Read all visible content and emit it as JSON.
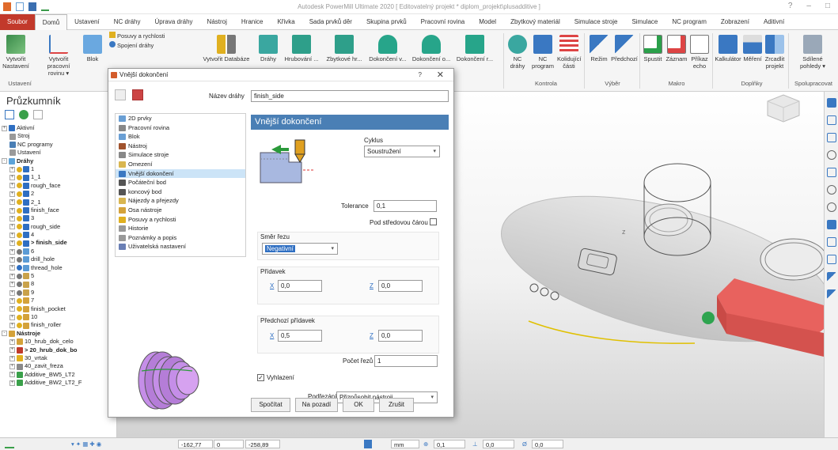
{
  "app": {
    "title": "Autodesk PowerMill Ultimate 2020  [ Editovatelný projekt * diplom_projekt\\plusadditive ]"
  },
  "tabs": [
    "Soubor",
    "Domů",
    "Ustavení",
    "NC dráhy",
    "Úprava dráhy",
    "Nástroj",
    "Hranice",
    "Křivka",
    "Sada prvků děr",
    "Skupina prvků",
    "Pracovní rovina",
    "Model",
    "Zbytkový materiál",
    "Simulace stroje",
    "Simulace",
    "NC program",
    "Zobrazení",
    "Aditivní"
  ],
  "ribbon": {
    "vytvorit_nastaveni": "Vytvořit Nastavení",
    "vytvorit_pracovni_rovinu": "Vytvořit pracovní rovinu ▾",
    "blok": "Blok",
    "posuvy": "Posuvy a rychlosti",
    "spojeni": "Spojení dráhy",
    "vytvorit_nastroj": "Vytvořit Databáze",
    "drahy": "Dráhy",
    "hrubovani": "Hrubování ...",
    "zbytkove": "Zbytkové hr...",
    "dokonceni_v": "Dokončení v...",
    "dokonceni_o": "Dokončení o...",
    "dokonceni_r": "Dokončení r...",
    "nc_drahy": "NC dráhy",
    "nc_program": "NC program",
    "kolidujici": "Kolidující části",
    "rezim": "Režim",
    "predchozi": "Předchozí",
    "spustit": "Spustit",
    "zaznam": "Záznam",
    "prikaz": "Příkaz echo",
    "kalkulator": "Kalkulátor",
    "mereni": "Měření",
    "zrcadlit": "Zrcadlit projekt",
    "sdilene": "Sdílené pohledy ▾",
    "groups": {
      "ustaveni": "Ustavení",
      "kontrola": "Kontrola",
      "vyber": "Výběr",
      "makro": "Makro",
      "doplnky": "Doplňky",
      "spoluprace": "Spolupracovat"
    }
  },
  "explorer": {
    "title": "Průzkumník",
    "tree": [
      {
        "label": "Aktivní",
        "indent": 0,
        "pm": "+",
        "color": "#2f6fc2"
      },
      {
        "label": "Stroj",
        "indent": 1,
        "pm": "",
        "color": "#999"
      },
      {
        "label": "NC programy",
        "indent": 1,
        "pm": "",
        "color": "#4a7fb5"
      },
      {
        "label": "Ustavení",
        "indent": 1,
        "pm": "",
        "color": "#9a9a9a"
      },
      {
        "label": "Dráhy",
        "indent": 0,
        "pm": "-",
        "color": "#5ba3d9",
        "bold": true
      },
      {
        "label": "1",
        "indent": 1,
        "pm": "+",
        "color": "#2f6fc2",
        "status": "#e0b020"
      },
      {
        "label": "1_1",
        "indent": 1,
        "pm": "+",
        "color": "#2f6fc2",
        "status": "#e0b020"
      },
      {
        "label": "rough_face",
        "indent": 1,
        "pm": "+",
        "color": "#2f6fc2",
        "status": "#e0b020"
      },
      {
        "label": "2",
        "indent": 1,
        "pm": "+",
        "color": "#2f6fc2",
        "status": "#e0b020"
      },
      {
        "label": "2_1",
        "indent": 1,
        "pm": "+",
        "color": "#2f6fc2",
        "status": "#e0b020"
      },
      {
        "label": "finish_face",
        "indent": 1,
        "pm": "+",
        "color": "#2f6fc2",
        "status": "#e0b020"
      },
      {
        "label": "3",
        "indent": 1,
        "pm": "+",
        "color": "#2f6fc2",
        "status": "#e0b020"
      },
      {
        "label": "rough_side",
        "indent": 1,
        "pm": "+",
        "color": "#2f6fc2",
        "status": "#e0b020"
      },
      {
        "label": "4",
        "indent": 1,
        "pm": "+",
        "color": "#2f6fc2",
        "status": "#e0b020"
      },
      {
        "label": "> finish_side",
        "indent": 1,
        "pm": "+",
        "color": "#2f6fc2",
        "status": "#e0b020",
        "bold": true
      },
      {
        "label": "6",
        "indent": 1,
        "pm": "+",
        "color": "#5b9bd5",
        "status": "#777"
      },
      {
        "label": "drill_hole",
        "indent": 1,
        "pm": "+",
        "color": "#5b9bd5",
        "status": "#777"
      },
      {
        "label": "thread_hole",
        "indent": 1,
        "pm": "+",
        "color": "#5b9bd5",
        "status": "#2f6fc2"
      },
      {
        "label": "5",
        "indent": 1,
        "pm": "+",
        "color": "#c9a24a",
        "status": "#777"
      },
      {
        "label": "8",
        "indent": 1,
        "pm": "+",
        "color": "#c9a24a",
        "status": "#777"
      },
      {
        "label": "9",
        "indent": 1,
        "pm": "+",
        "color": "#c9a24a",
        "status": "#777"
      },
      {
        "label": "7",
        "indent": 1,
        "pm": "+",
        "color": "#d4a23a",
        "status": "#e0b020"
      },
      {
        "label": "finish_pocket",
        "indent": 1,
        "pm": "+",
        "color": "#d4a23a",
        "status": "#e0b020"
      },
      {
        "label": "10",
        "indent": 1,
        "pm": "+",
        "color": "#d4a23a",
        "status": "#e0b020"
      },
      {
        "label": "finish_roller",
        "indent": 1,
        "pm": "+",
        "color": "#d4a23a",
        "status": "#e0b020"
      },
      {
        "label": "Nástroje",
        "indent": 0,
        "pm": "-",
        "color": "#d4a23a",
        "bold": true
      },
      {
        "label": "10_hrub_dok_celo",
        "indent": 1,
        "pm": "+",
        "color": "#d4a23a"
      },
      {
        "label": "> 20_hrub_dok_bo",
        "indent": 1,
        "pm": "+",
        "color": "#c0392b",
        "bold": true
      },
      {
        "label": "30_vrtak",
        "indent": 1,
        "pm": "+",
        "color": "#e0b020"
      },
      {
        "label": "40_zavit_freza",
        "indent": 1,
        "pm": "+",
        "color": "#8a8a8a"
      },
      {
        "label": "Additive_BW5_LT2",
        "indent": 1,
        "pm": "+",
        "color": "#3aa04a"
      },
      {
        "label": "Additive_BW2_LT2_F",
        "indent": 1,
        "pm": "+",
        "color": "#3aa04a"
      }
    ]
  },
  "dialog": {
    "title": "Vnější dokončení",
    "help": "?",
    "close": "✕",
    "name_label": "Název dráhy",
    "name_value": "finish_side",
    "nav": [
      {
        "label": "2D prvky",
        "color": "#6a9fd4"
      },
      {
        "label": "Pracovní rovina",
        "color": "#888"
      },
      {
        "label": "Blok",
        "color": "#6a9fd4"
      },
      {
        "label": "Nástroj",
        "color": "#a0522d"
      },
      {
        "label": "Simulace stroje",
        "color": "#888"
      },
      {
        "label": "Omezení",
        "color": "#d9b650"
      },
      {
        "label": "Vnější dokončení",
        "color": "#3a78c2",
        "selected": true
      },
      {
        "label": "Počáteční bod",
        "color": "#555"
      },
      {
        "label": "koncový bod",
        "color": "#555"
      },
      {
        "label": "Nájezdy a přejezdy",
        "color": "#d9b650"
      },
      {
        "label": "Osa nástroje",
        "color": "#d4a23a"
      },
      {
        "label": "Posuvy a rychlosti",
        "color": "#e0b020"
      },
      {
        "label": "Historie",
        "color": "#999"
      },
      {
        "label": "Poznámky a popis",
        "color": "#999"
      },
      {
        "label": "Uživatelská nastavení",
        "color": "#6a7fb5"
      }
    ],
    "header": "Vnější dokončení",
    "cycle_label": "Cyklus",
    "cycle_value": "Soustružení",
    "tolerance_label": "Tolerance",
    "tolerance_value": "0,1",
    "below_center_label": "Pod středovou čárou",
    "cut_dir_label": "Směr řezu",
    "cut_dir_value": "Negativní",
    "allowance_label": "Přídavek",
    "x_label": "X",
    "z_label": "Z",
    "allow_x": "0,0",
    "allow_z": "0,0",
    "prev_allowance_label": "Předchozí přídavek",
    "prev_x": "0,5",
    "prev_z": "0,0",
    "cuts_label": "Počet řezů",
    "cuts_value": "1",
    "smoothing_label": "Vyhlazení",
    "undercut_label": "Podřezání",
    "undercut_value": "Přizpůsobit nástroji",
    "buttons": {
      "calc": "Spočítat",
      "background": "Na pozadí",
      "ok": "OK",
      "cancel": "Zrušit"
    }
  },
  "status": {
    "x": "-162,77",
    "y": "0",
    "z": "-258,89",
    "unit": "mm",
    "tol": "0,1",
    "thick": "0,0",
    "dia": "0,0"
  },
  "colors": {
    "file_tab": "#c2392b",
    "dialog_header": "#4a7fb5",
    "tool_red": "#e8625e",
    "green_tool": "#2ea44f"
  }
}
